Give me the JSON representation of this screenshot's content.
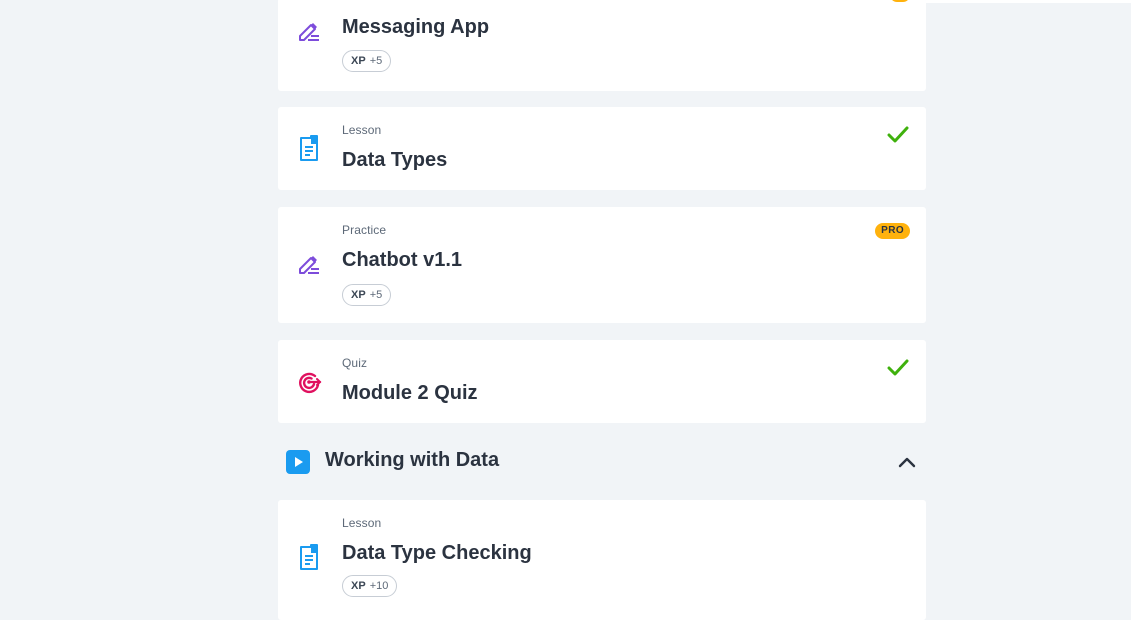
{
  "colors": {
    "background": "#f1f4f7",
    "card": "#ffffff",
    "practice_icon": "#7d4cdb",
    "lesson_icon": "#1a9bf0",
    "quiz_icon": "#e0115f",
    "check": "#3fb10d",
    "pro_badge": "#ffb20d"
  },
  "items": [
    {
      "kind": "",
      "title": "Messaging App",
      "icon": "pencil-edit-icon",
      "xp_label": "XP",
      "xp_value": "+5",
      "status": "pro-badge-partially-visible"
    },
    {
      "kind": "Lesson",
      "title": "Data Types",
      "icon": "document-icon",
      "status": "completed-check"
    },
    {
      "kind": "Practice",
      "title": "Chatbot v1.1",
      "icon": "pencil-edit-icon",
      "xp_label": "XP",
      "xp_value": "+5",
      "badge": "PRO"
    },
    {
      "kind": "Quiz",
      "title": "Module 2 Quiz",
      "icon": "target-icon",
      "status": "completed-check"
    }
  ],
  "section": {
    "title": "Working with Data",
    "icon": "play-icon",
    "toggle_icon": "chevron-up-icon"
  },
  "section_items": [
    {
      "kind": "Lesson",
      "title": "Data Type Checking",
      "icon": "document-icon",
      "xp_label": "XP",
      "xp_value": "+10"
    }
  ]
}
